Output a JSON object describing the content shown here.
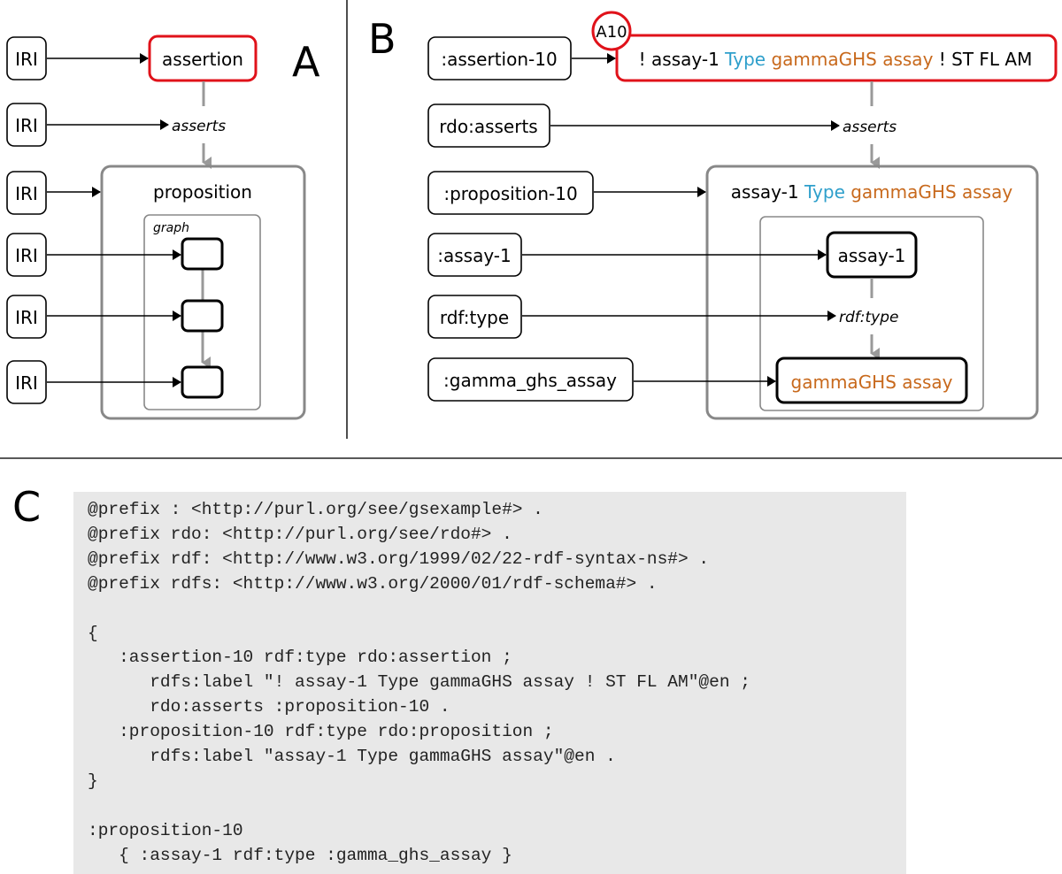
{
  "colors": {
    "assertion_border": "#e0121a",
    "type_blue": "#2e9fcb",
    "class_orange": "#c8691c",
    "gray_connector": "#999999",
    "code_background": "#e8e8e8"
  },
  "panel_a": {
    "letter": "A",
    "iri_labels": [
      "IRI",
      "IRI",
      "IRI",
      "IRI",
      "IRI",
      "IRI"
    ],
    "assertion_label": "assertion",
    "asserts_label": "asserts",
    "proposition_label": "proposition",
    "graph_label": "graph"
  },
  "panel_b": {
    "letter": "B",
    "iri_labels": [
      ":assertion-10",
      "rdo:asserts",
      ":proposition-10",
      ":assay-1",
      "rdf:type",
      ":gamma_ghs_assay"
    ],
    "assertion_badge": "A10",
    "assertion_text": {
      "prefix": "! assay-1 ",
      "type_word": "Type",
      "class_name": " gammaGHS assay",
      "suffix": " ! ST FL AM"
    },
    "asserts_label": "asserts",
    "proposition_text": {
      "subject": "assay-1 ",
      "type_word": "Type",
      "class_name": " gammaGHS assay"
    },
    "subject_node": "assay-1",
    "predicate_label": "rdf:type",
    "object_node": "gammaGHS assay"
  },
  "panel_c": {
    "letter": "C",
    "code_lines": [
      "@prefix : <http://purl.org/see/gsexample#> .",
      "@prefix rdo: <http://purl.org/see/rdo#> .",
      "@prefix rdf: <http://www.w3.org/1999/02/22-rdf-syntax-ns#> .",
      "@prefix rdfs: <http://www.w3.org/2000/01/rdf-schema#> .",
      "",
      "{",
      "   :assertion-10 rdf:type rdo:assertion ;",
      "      rdfs:label \"! assay-1 Type gammaGHS assay ! ST FL AM\"@en ;",
      "      rdo:asserts :proposition-10 .",
      "   :proposition-10 rdf:type rdo:proposition ;",
      "      rdfs:label \"assay-1 Type gammaGHS assay\"@en .",
      "}",
      "",
      ":proposition-10",
      "   { :assay-1 rdf:type :gamma_ghs_assay }"
    ]
  }
}
